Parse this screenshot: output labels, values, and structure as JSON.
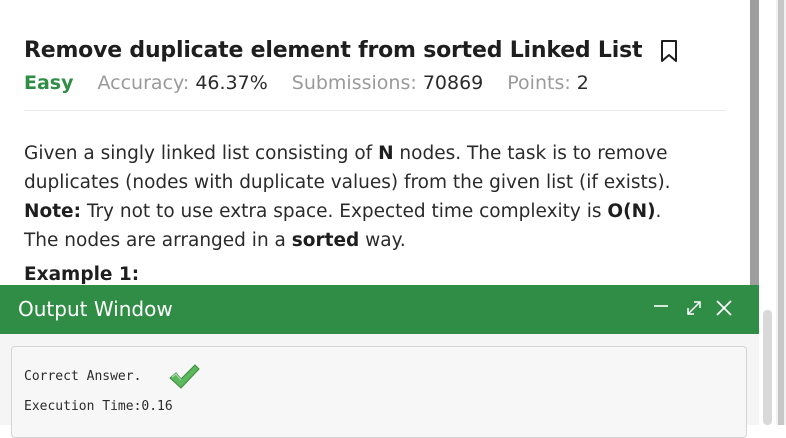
{
  "problem": {
    "title": "Remove duplicate element from sorted Linked List",
    "difficulty": "Easy",
    "accuracy_label": "Accuracy:",
    "accuracy_value": "46.37%",
    "submissions_label": "Submissions:",
    "submissions_value": "70869",
    "points_label": "Points:",
    "points_value": "2",
    "desc": {
      "l1_a": "Given a singly linked list consisting of ",
      "l1_b": "N",
      "l1_c": " nodes. The task is to remove",
      "l2": "duplicates (nodes with duplicate values) from the given list (if exists).",
      "l3_a": "Note:",
      "l3_b": " Try not to use extra space. Expected time complexity is ",
      "l3_c": "O(N)",
      "l3_d": ".",
      "l4_a": "The nodes are arranged in a ",
      "l4_b": "sorted",
      "l4_c": " way."
    },
    "example_heading": "Example 1:"
  },
  "output_window": {
    "title": "Output Window",
    "result_text": "Correct Answer.",
    "execution_text": "Execution Time:0.16"
  },
  "icons": {
    "bookmark": "bookmark-icon",
    "minimize": "minimize-icon",
    "expand": "expand-icon",
    "close": "close-icon",
    "check": "checkmark-icon"
  },
  "colors": {
    "accent_green": "#2f8d46",
    "check_green": "#5cb85c"
  }
}
